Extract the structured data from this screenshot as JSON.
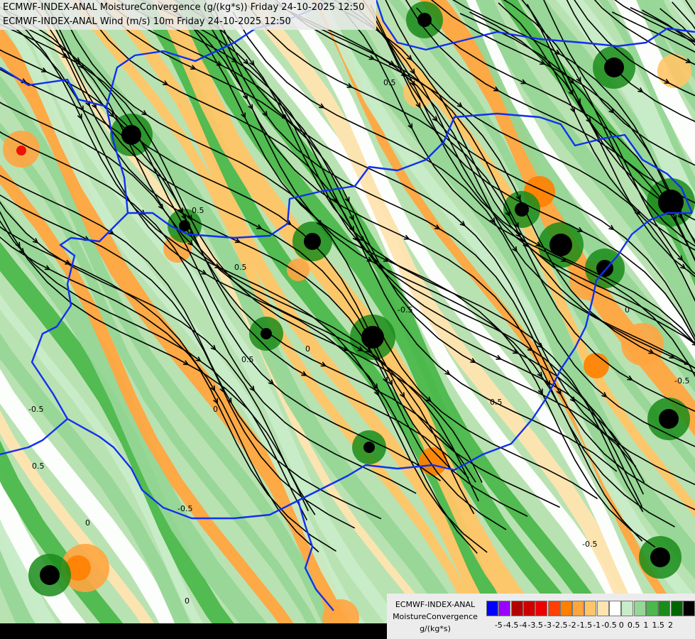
{
  "header": {
    "line1": "ECMWF-INDEX-ANAL MoistureConvergence (g/(kg*s)) Friday 24-10-2025 12:50",
    "line2": "ECMWF-INDEX-ANAL Wind (m/s) 10m Friday 24-10-2025 12:50"
  },
  "legend": {
    "line1": "ECMWF-INDEX-ANAL",
    "line2": "MoistureConvergence",
    "unit": "g/(kg*s)",
    "ticks": [
      "-5",
      "-4.5",
      "-4",
      "-3.5",
      "-3",
      "-2.5",
      "-2",
      "-1.5",
      "-1",
      "-0.5",
      "0",
      "0.5",
      "1",
      "1.5",
      "2"
    ],
    "colors": [
      "#0000ff",
      "#9900ff",
      "#b30000",
      "#cc0000",
      "#ee0000",
      "#ff4000",
      "#ff8000",
      "#ffa540",
      "#ffc566",
      "#ffe4b0",
      "#ffffff",
      "#c8ecc8",
      "#96d696",
      "#4cb84c",
      "#1a8c1a",
      "#006600",
      "#000000"
    ]
  },
  "contour_labels": [
    "0",
    "0.5",
    "-0.5",
    "0.5",
    "0",
    "-0.5",
    "0.5",
    "0",
    "-0.5",
    "-0.5",
    "0.5",
    "0",
    "0.5",
    "-0.5",
    "0",
    "0.5"
  ]
}
